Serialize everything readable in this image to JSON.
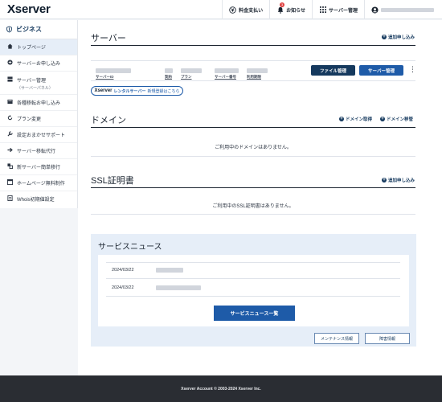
{
  "app": {
    "logo": "Xserver"
  },
  "topnav": {
    "billing": "料金支払い",
    "notifications": "お知らせ",
    "notification_count": "1",
    "server_mgmt": "サーバー管理"
  },
  "sidebar": {
    "header": "ビジネス",
    "items": [
      {
        "label": "トップページ"
      },
      {
        "label": "サーバーお申し込み"
      },
      {
        "label": "サーバー管理",
        "sub": "（サーバーパネル）"
      },
      {
        "label": "各種移転お申し込み"
      },
      {
        "label": "プラン変更"
      },
      {
        "label": "設定おまかせサポート"
      },
      {
        "label": "サーバー移転代行"
      },
      {
        "label": "新サーバー簡単移行"
      },
      {
        "label": "ホームページ無料制作"
      },
      {
        "label": "Whois初期値設定"
      }
    ]
  },
  "server": {
    "title": "サーバー",
    "add_link": "追加申し込み",
    "columns": [
      "サーバーID",
      "契約",
      "プラン",
      "サーバー番号",
      "利用期限"
    ],
    "file_btn": "ファイル管理",
    "panel_btn": "サーバー管理",
    "pill_brand": "Xserver",
    "pill_product": "レンタルサーバー",
    "pill_text": "新規登録はこちら"
  },
  "domain": {
    "title": "ドメイン",
    "get_link": "ドメイン取得",
    "transfer_link": "ドメイン移管",
    "empty": "ご利用中のドメインはありません。"
  },
  "ssl": {
    "title": "SSL証明書",
    "add_link": "追加申し込み",
    "empty": "ご利用中のSSL証明書はありません。"
  },
  "news": {
    "title": "サービスニュース",
    "items": [
      {
        "date": "2024/03/22"
      },
      {
        "date": "2024/03/22"
      }
    ],
    "all_btn": "サービスニュース一覧",
    "maintenance_btn": "メンテナンス情報",
    "incident_btn": "障害情報"
  },
  "footer": {
    "text": "Xserver Account © 2003-2024 Xserver Inc."
  }
}
